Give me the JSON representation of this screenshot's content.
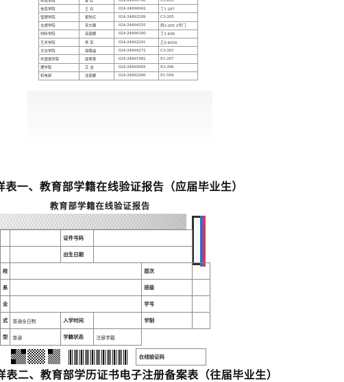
{
  "directory": {
    "rows": [
      {
        "dept": "环境学院",
        "name": "某  红",
        "tel": "024-24690700",
        "room": "E3-203"
      },
      {
        "dept": "信息学院",
        "name": "王  石",
        "tel": "024-24690042",
        "room": "丁1-207"
      },
      {
        "dept": "管理学院",
        "name": "翟秋红",
        "tel": "024-24692209",
        "room": "C3-205"
      },
      {
        "dept": "交通学院",
        "name": "宋文珊",
        "tel": "024-24694355",
        "room": "丙3-205 2号门"
      },
      {
        "dept": "材料学院",
        "name": "高丽娜",
        "tel": "024-24690300",
        "room": "丁2-406"
      },
      {
        "dept": "艺术学院",
        "name": "李  军",
        "tel": "024-24692291",
        "room": "乙5-4054"
      },
      {
        "dept": "文法学院",
        "name": "郭路遥",
        "tel": "024-24694272",
        "room": "C3-201"
      },
      {
        "dept": "外国语学院",
        "name": "邵菁菁",
        "tel": "024-24691982",
        "room": "E1-267"
      },
      {
        "dept": "理学院",
        "name": "艾  洁",
        "tel": "024-24695065",
        "room": "E3-306"
      },
      {
        "dept": "机电部",
        "name": "沈丽娜",
        "tel": "024-24692260",
        "room": "E1-504"
      }
    ]
  },
  "caption_1": "样表一、教育部学籍在线验证报告（应届毕业生）",
  "report": {
    "title": "教育部学籍在线验证报告",
    "labels": {
      "id_number": "证件号码",
      "birth_date": "出生日期",
      "level": "层次",
      "class": "班级",
      "student_no": "学号",
      "enroll_time": "入学时间",
      "duration": "学制",
      "status_label": "学籍状态",
      "verify_code": "在线验证码"
    },
    "row_stubs": [
      "校",
      "系",
      "业",
      "式",
      "型"
    ],
    "values": {
      "study_form": "普通全日制",
      "category": "普通",
      "status": "注册学籍"
    }
  },
  "caption_2": "样表二、教育部学历证书电子注册备案表（往届毕业生）",
  "colors": {
    "photo_blue": "#2f6fd0",
    "photo_red": "#d9365e",
    "grid": "#8a8a8a"
  }
}
